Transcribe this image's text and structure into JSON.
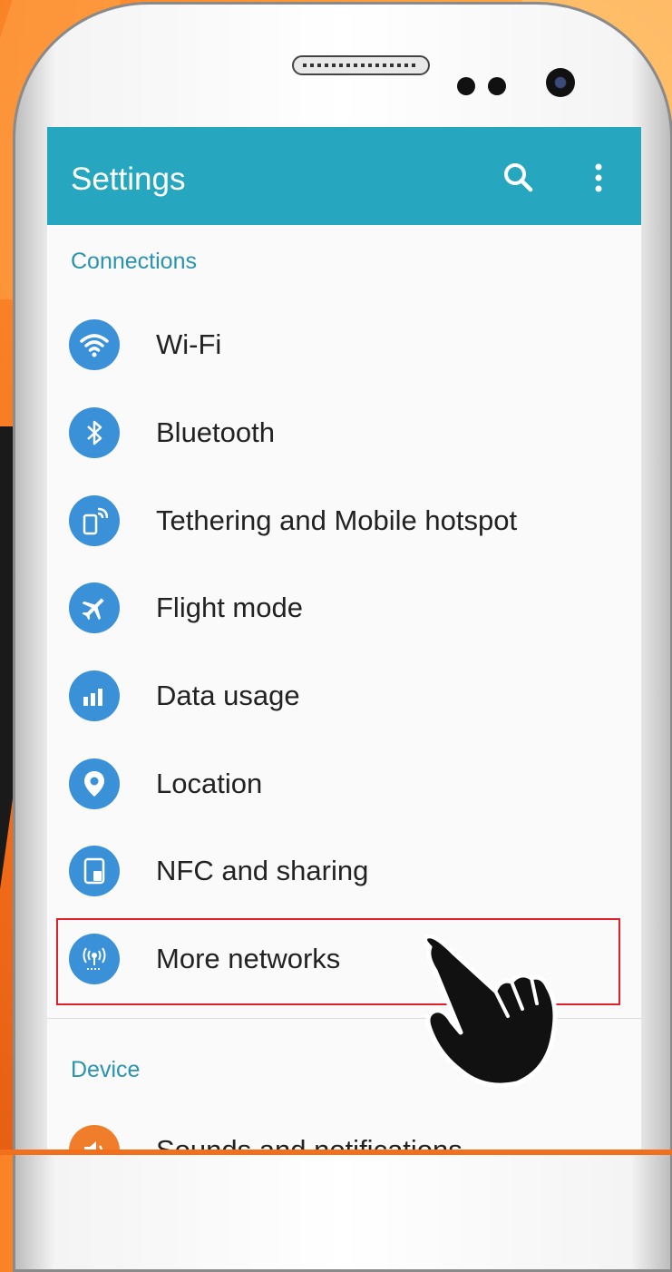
{
  "appbar": {
    "title": "Settings",
    "search_icon": "search-icon",
    "more_icon": "more-vert-icon",
    "color": "#27a7bf"
  },
  "connections": {
    "header": "Connections",
    "items": [
      {
        "label": "Wi-Fi",
        "icon": "wifi-icon"
      },
      {
        "label": "Bluetooth",
        "icon": "bluetooth-icon"
      },
      {
        "label": "Tethering and Mobile hotspot",
        "icon": "hotspot-icon"
      },
      {
        "label": "Flight mode",
        "icon": "airplane-icon"
      },
      {
        "label": "Data usage",
        "icon": "data-usage-icon"
      },
      {
        "label": "Location",
        "icon": "location-icon"
      },
      {
        "label": "NFC and sharing",
        "icon": "nfc-icon"
      },
      {
        "label": "More networks",
        "icon": "antenna-icon"
      }
    ]
  },
  "device": {
    "header": "Device",
    "items": [
      {
        "label": "Sounds and notifications",
        "icon": "sound-icon"
      }
    ]
  },
  "colors": {
    "icon_blue": "#3a91d8",
    "header_teal": "#2a93ad",
    "highlight_red": "#e0202a"
  }
}
